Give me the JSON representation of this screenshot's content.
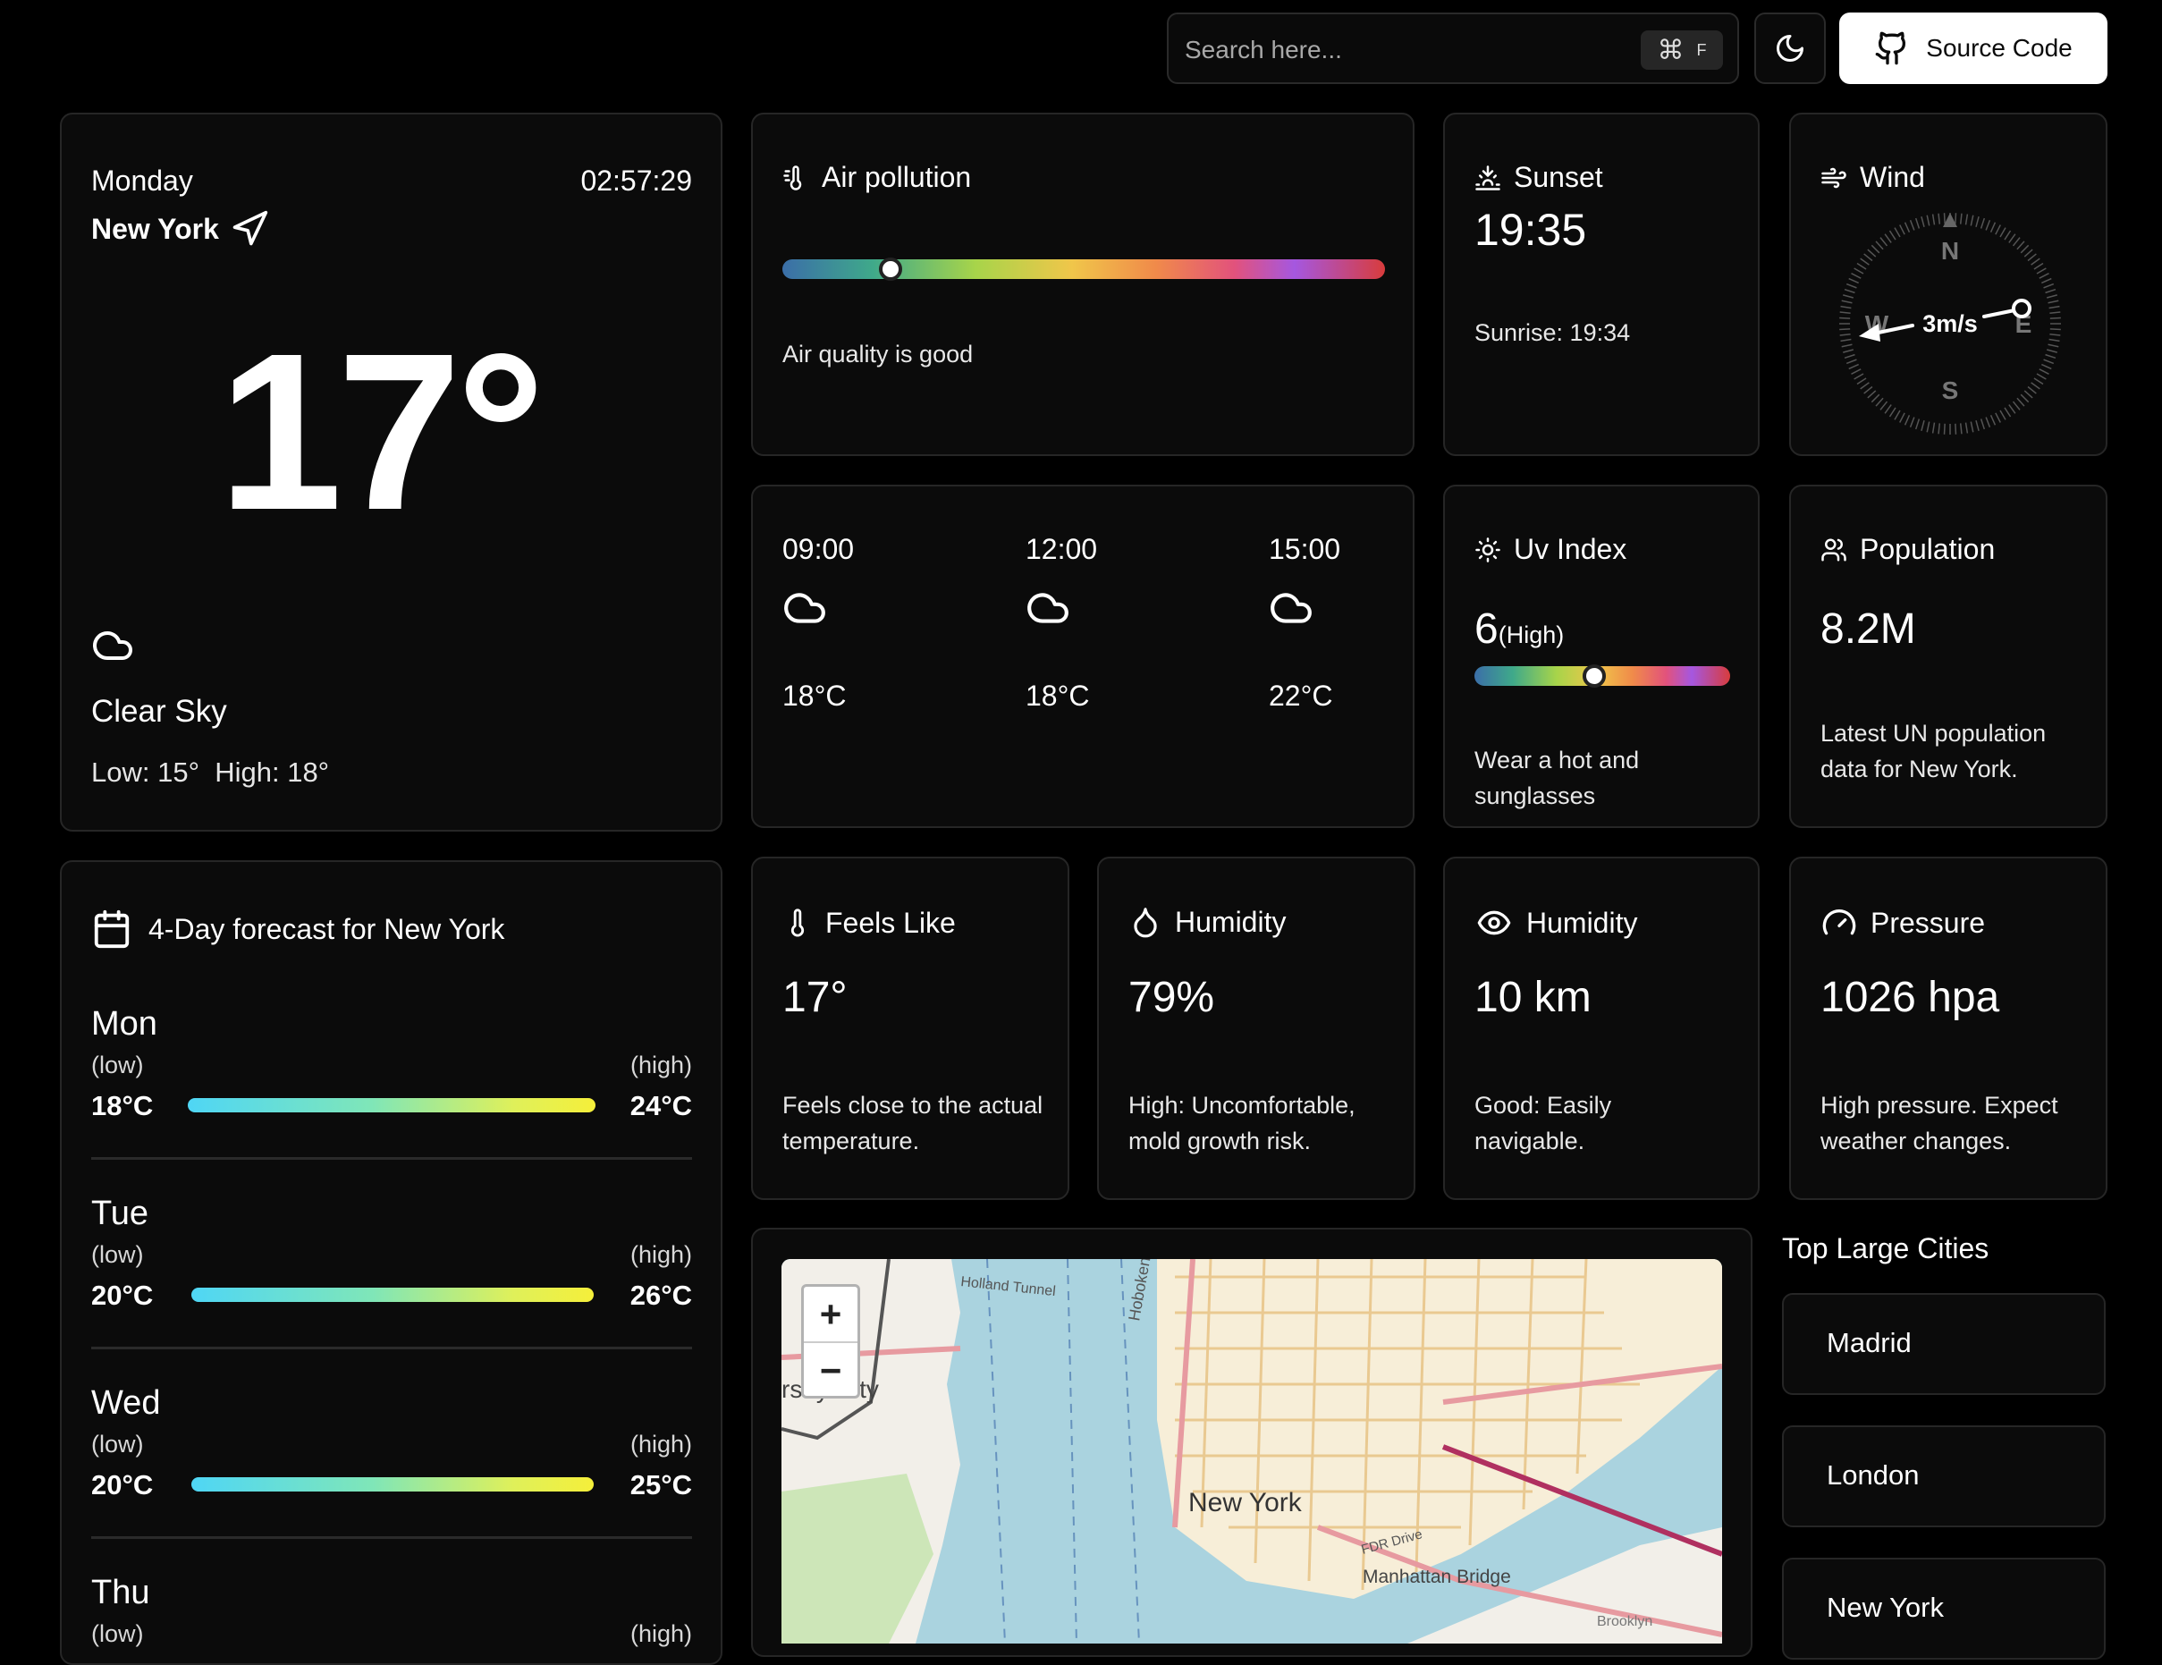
{
  "header": {
    "search_placeholder": "Search here...",
    "shortcut_cmd": "⌘",
    "shortcut_key": "F",
    "theme_icon": "moon-icon",
    "source_label": "Source Code",
    "source_icon": "github-icon"
  },
  "current": {
    "day": "Monday",
    "time": "02:57:29",
    "city": "New York",
    "temp": "17°",
    "condition": "Clear Sky",
    "low": "Low: 15°",
    "high": "High: 18°",
    "icon": "cloud-icon"
  },
  "air_pollution": {
    "title": "Air pollution",
    "level": 0.18,
    "description": "Air quality is good"
  },
  "sunset": {
    "title": "Sunset",
    "value": "19:35",
    "sunrise": "Sunrise: 19:34"
  },
  "wind": {
    "title": "Wind",
    "speed": "3m/s",
    "dir_n": "N",
    "dir_e": "E",
    "dir_s": "S",
    "dir_w": "W"
  },
  "hourly": [
    {
      "time": "09:00",
      "temp": "18°C",
      "icon": "cloud-icon"
    },
    {
      "time": "12:00",
      "temp": "18°C",
      "icon": "cloud-icon"
    },
    {
      "time": "15:00",
      "temp": "22°C",
      "icon": "cloud-icon"
    }
  ],
  "uv": {
    "title": "Uv Index",
    "value": "6",
    "level": "(High)",
    "fraction": 0.47,
    "advice": "Wear a hot and sunglasses"
  },
  "population": {
    "title": "Population",
    "value": "8.2M",
    "description": "Latest UN population data for New York."
  },
  "forecast": {
    "title": "4-Day forecast for New York",
    "low_label": "(low)",
    "high_label": "(high)",
    "days": [
      {
        "day": "Mon",
        "low": "18°C",
        "high": "24°C"
      },
      {
        "day": "Tue",
        "low": "20°C",
        "high": "26°C"
      },
      {
        "day": "Wed",
        "low": "20°C",
        "high": "25°C"
      },
      {
        "day": "Thu"
      }
    ]
  },
  "feels_like": {
    "title": "Feels Like",
    "value": "17°",
    "description": "Feels close to the actual temperature."
  },
  "humidity": {
    "title": "Humidity",
    "value": "79%",
    "description": "High: Uncomfortable, mold growth risk."
  },
  "visibility": {
    "title": "Humidity",
    "value": "10 km",
    "description": "Good: Easily navigable."
  },
  "pressure": {
    "title": "Pressure",
    "value": "1026 hpa",
    "description": "High pressure. Expect weather changes."
  },
  "map": {
    "zoom_in": "+",
    "zoom_out": "−",
    "labels": {
      "city": "New York",
      "jersey": "rsey City",
      "holland": "Holland Tunnel",
      "hoboken": "Hoboken",
      "manhattan_bridge": "Manhattan Bridge",
      "fdr": "FDR Drive",
      "brooklyn": "Brooklyn"
    }
  },
  "cities": {
    "title": "Top Large Cities",
    "items": [
      "Madrid",
      "London",
      "New York"
    ]
  }
}
